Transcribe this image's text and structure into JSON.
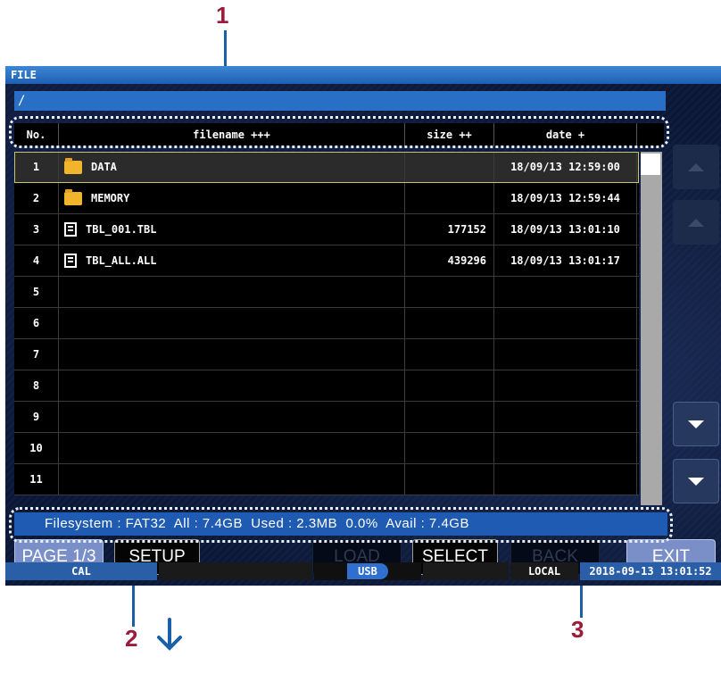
{
  "callouts": {
    "one": "1",
    "two": "2",
    "three": "3"
  },
  "window": {
    "title": "FILE",
    "path": "/"
  },
  "table": {
    "headers": {
      "no": "No.",
      "filename": "filename +++",
      "size": "size ++",
      "date": "date +"
    },
    "rows": [
      {
        "no": "1",
        "icon": "folder-icon",
        "name": "DATA",
        "size": "",
        "date": "18/09/13 12:59:00",
        "selected": true
      },
      {
        "no": "2",
        "icon": "folder-icon",
        "name": "MEMORY",
        "size": "",
        "date": "18/09/13 12:59:44"
      },
      {
        "no": "3",
        "icon": "file-icon",
        "name": "TBL_001.TBL",
        "size": "177152",
        "date": "18/09/13 13:01:10"
      },
      {
        "no": "4",
        "icon": "file-icon",
        "name": "TBL_ALL.ALL",
        "size": "439296",
        "date": "18/09/13 13:01:17"
      },
      {
        "no": "5",
        "icon": "",
        "name": "",
        "size": "",
        "date": ""
      },
      {
        "no": "6",
        "icon": "",
        "name": "",
        "size": "",
        "date": ""
      },
      {
        "no": "7",
        "icon": "",
        "name": "",
        "size": "",
        "date": ""
      },
      {
        "no": "8",
        "icon": "",
        "name": "",
        "size": "",
        "date": ""
      },
      {
        "no": "9",
        "icon": "",
        "name": "",
        "size": "",
        "date": ""
      },
      {
        "no": "10",
        "icon": "",
        "name": "",
        "size": "",
        "date": ""
      },
      {
        "no": "11",
        "icon": "",
        "name": "",
        "size": "",
        "date": ""
      }
    ]
  },
  "filesystem": "Filesystem : FAT32  All : 7.4GB  Used : 2.3MB  0.0%  Avail : 7.4GB",
  "buttons": {
    "page": "PAGE 1/3",
    "setup": "SETUP",
    "load": "LOAD",
    "select": "SELECT",
    "back": "BACK",
    "exit": "EXIT"
  },
  "status": {
    "cal": "CAL",
    "usb": "USB",
    "local": "LOCAL",
    "datetime": "2018-09-13 13:01:52"
  },
  "colors": {
    "callout": "#9b1b3a",
    "accent": "#1b5fa8",
    "bar": "#1f5bb3"
  }
}
